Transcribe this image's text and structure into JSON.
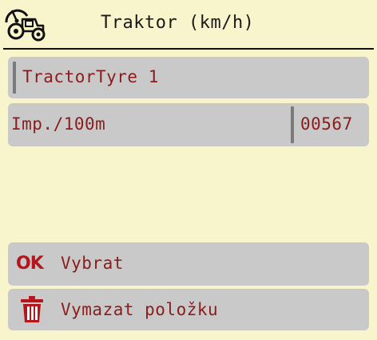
{
  "header": {
    "title": "Traktor (km/h)",
    "icon": "tractor-speed-icon"
  },
  "fields": {
    "name_value": "TractorTyre 1",
    "impulse_label": "Imp./100m",
    "impulse_value": "00567"
  },
  "actions": {
    "ok_badge": "OK",
    "select_label": "Vybrat",
    "delete_label": "Vymazat položku",
    "delete_icon": "trash-icon"
  },
  "colors": {
    "background": "#f8f4cc",
    "row": "#c9c9c9",
    "text_accent": "#8b1c1c",
    "ok_red": "#b8141c"
  }
}
